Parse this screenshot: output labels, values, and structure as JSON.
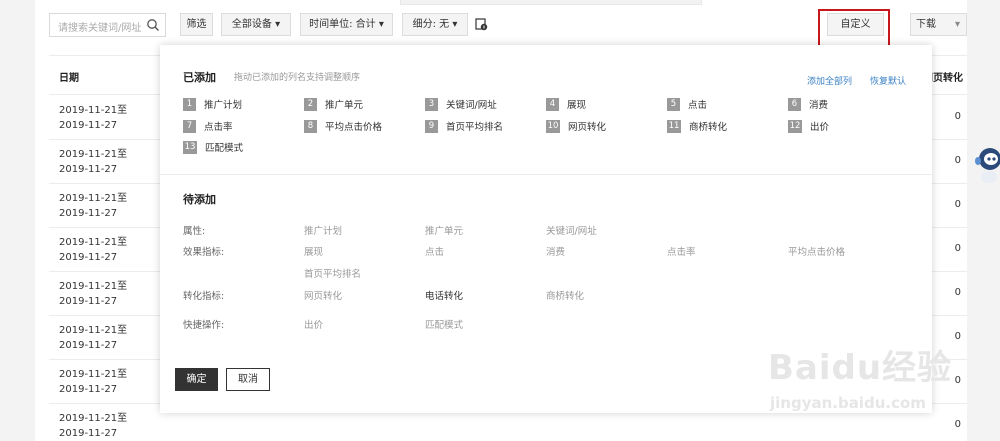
{
  "toolbar": {
    "search_placeholder": "请搜索关键词/网址",
    "filter": "筛选",
    "device": "全部设备",
    "time_unit": "时间单位: 合计",
    "breakdown": "细分: 无",
    "custom": "自定义",
    "download": "下载"
  },
  "table": {
    "col_date": "日期",
    "col_web_conv": "网页转化",
    "rows": [
      {
        "date": "2019-11-21至2019-11-27",
        "value": "0"
      },
      {
        "date": "2019-11-21至2019-11-27",
        "value": "0"
      },
      {
        "date": "2019-11-21至2019-11-27",
        "value": "0"
      },
      {
        "date": "2019-11-21至2019-11-27",
        "value": "0"
      },
      {
        "date": "2019-11-21至2019-11-27",
        "value": "0"
      },
      {
        "date": "2019-11-21至2019-11-27",
        "value": "0"
      },
      {
        "date": "2019-11-21至2019-11-27",
        "value": "0"
      },
      {
        "date": "2019-11-21至2019-11-27",
        "value": "0"
      }
    ]
  },
  "panel": {
    "added_title": "已添加",
    "added_hint": "拖动已添加的列名支持调整顺序",
    "add_all": "添加全部列",
    "restore_default": "恢复默认",
    "added_items": [
      {
        "num": "1",
        "label": "推广计划"
      },
      {
        "num": "2",
        "label": "推广单元"
      },
      {
        "num": "3",
        "label": "关键词/网址"
      },
      {
        "num": "4",
        "label": "展现"
      },
      {
        "num": "5",
        "label": "点击"
      },
      {
        "num": "6",
        "label": "消费"
      },
      {
        "num": "7",
        "label": "点击率"
      },
      {
        "num": "8",
        "label": "平均点击价格"
      },
      {
        "num": "9",
        "label": "首页平均排名"
      },
      {
        "num": "10",
        "label": "网页转化"
      },
      {
        "num": "11",
        "label": "商桥转化"
      },
      {
        "num": "12",
        "label": "出价"
      },
      {
        "num": "13",
        "label": "匹配模式"
      }
    ],
    "pending_title": "待添加",
    "groups": {
      "attr_label": "属性:",
      "attr": [
        "推广计划",
        "推广单元",
        "关键词/网址"
      ],
      "effect_label": "效果指标:",
      "effect": [
        "展现",
        "点击",
        "消费",
        "点击率",
        "平均点击价格",
        "首页平均排名"
      ],
      "conv_label": "转化指标:",
      "conv": [
        "网页转化",
        "电话转化",
        "商桥转化"
      ],
      "quick_label": "快捷操作:",
      "quick": [
        "出价",
        "匹配模式"
      ]
    },
    "ok": "确定",
    "cancel": "取消"
  },
  "watermark": {
    "text": "Baidu经验",
    "url": "jingyan.baidu.com"
  },
  "colors": {
    "accent_link": "#3b82c4",
    "highlight_box": "#c8161d",
    "dark_button": "#333333"
  }
}
